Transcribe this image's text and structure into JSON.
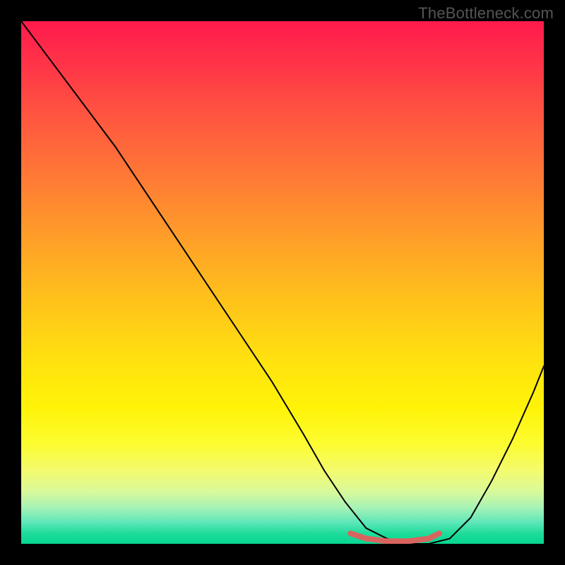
{
  "watermark": "TheBottleneck.com",
  "chart_data": {
    "type": "line",
    "title": "",
    "xlabel": "",
    "ylabel": "",
    "xlim": [
      0,
      100
    ],
    "ylim": [
      0,
      100
    ],
    "grid": false,
    "legend": false,
    "background_gradient": {
      "orientation": "vertical",
      "stops": [
        {
          "pos": 0.0,
          "color": "#ff1a4d"
        },
        {
          "pos": 0.3,
          "color": "#ff7a35"
        },
        {
          "pos": 0.6,
          "color": "#ffe20f"
        },
        {
          "pos": 0.85,
          "color": "#f4fb6e"
        },
        {
          "pos": 1.0,
          "color": "#06d690"
        }
      ]
    },
    "series": [
      {
        "name": "bottleneck-curve",
        "stroke": "#000000",
        "stroke_width": 2,
        "x": [
          0,
          6,
          12,
          18,
          24,
          30,
          36,
          42,
          48,
          54,
          58,
          62,
          66,
          70,
          74,
          78,
          82,
          86,
          90,
          94,
          98,
          100
        ],
        "y": [
          100,
          92,
          84,
          76,
          67,
          58,
          49,
          40,
          31,
          21,
          14,
          8,
          3,
          1,
          0,
          0,
          1,
          5,
          12,
          20,
          29,
          34
        ]
      }
    ],
    "highlight": {
      "name": "flat-minimum",
      "stroke": "#d9645f",
      "stroke_width": 8,
      "x": [
        63,
        66,
        70,
        74,
        78,
        80
      ],
      "y": [
        2.0,
        1.0,
        0.5,
        0.5,
        1.0,
        2.0
      ]
    }
  }
}
